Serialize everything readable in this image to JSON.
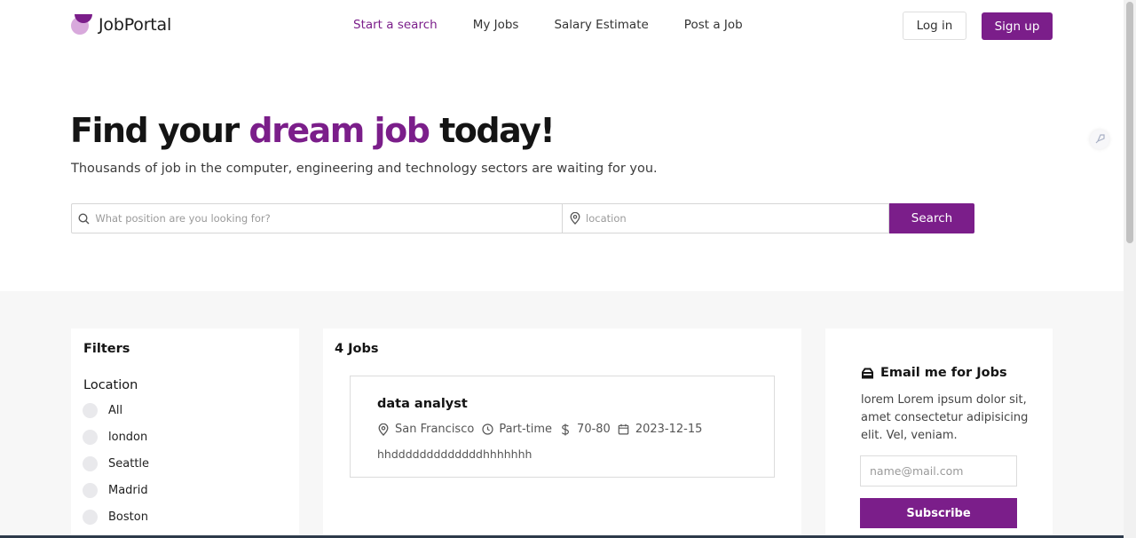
{
  "brand": {
    "name": "JobPortal",
    "accent": "#7b1e8a"
  },
  "nav": {
    "items": [
      {
        "label": "Start a search",
        "active": true
      },
      {
        "label": "My Jobs",
        "active": false
      },
      {
        "label": "Salary Estimate",
        "active": false
      },
      {
        "label": "Post a Job",
        "active": false
      }
    ],
    "login_label": "Log in",
    "signup_label": "Sign up"
  },
  "hero": {
    "title_start": "Find your",
    "title_accent": "dream job",
    "title_end": "today!",
    "subtitle": "Thousands of job in the computer, engineering and technology sectors are waiting for you."
  },
  "search": {
    "position_placeholder": "What position are you looking for?",
    "location_placeholder": "location",
    "button_label": "Search"
  },
  "filters": {
    "title": "Filters",
    "location_title": "Location",
    "locations": [
      "All",
      "london",
      "Seattle",
      "Madrid",
      "Boston"
    ]
  },
  "jobs": {
    "count_label": "4 Jobs",
    "list": [
      {
        "title": "data analyst",
        "location": "San Francisco",
        "type": "Part-time",
        "salary": "70-80",
        "date": "2023-12-15",
        "description": "hhdddddddddddddhhhhhhh"
      }
    ]
  },
  "subscribe": {
    "title": "Email me for Jobs",
    "text": "lorem Lorem ipsum dolor sit, amet consectetur adipisicing elit. Vel, veniam.",
    "email_placeholder": "name@mail.com",
    "button_label": "Subscribe"
  }
}
